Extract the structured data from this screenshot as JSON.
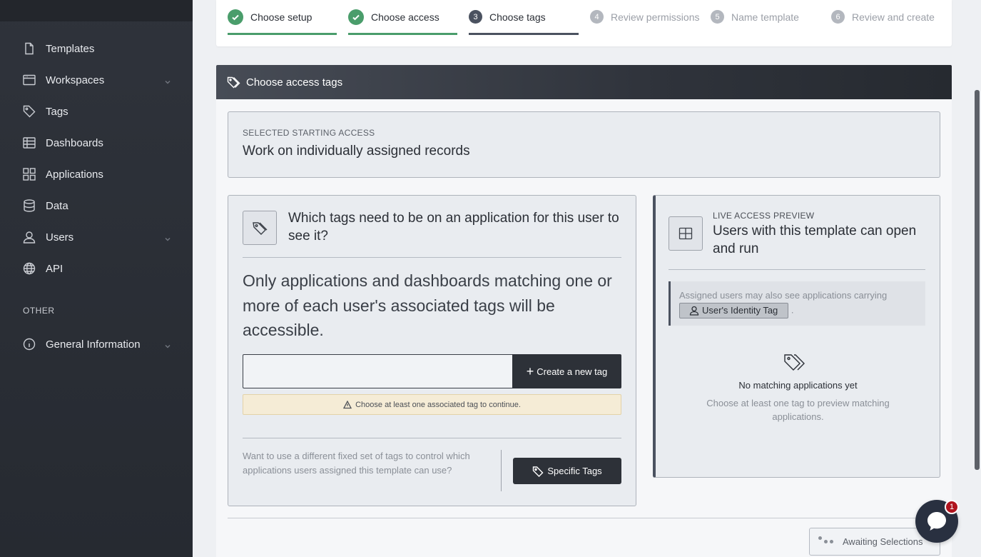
{
  "sidebar": {
    "items": [
      {
        "label": "Templates",
        "icon": "document-icon"
      },
      {
        "label": "Workspaces",
        "icon": "window-icon",
        "expandable": true
      },
      {
        "label": "Tags",
        "icon": "tag-icon"
      },
      {
        "label": "Dashboards",
        "icon": "table-icon"
      },
      {
        "label": "Applications",
        "icon": "grid-icon"
      },
      {
        "label": "Data",
        "icon": "database-icon"
      },
      {
        "label": "Users",
        "icon": "user-icon",
        "expandable": true
      },
      {
        "label": "API",
        "icon": "globe-icon"
      }
    ],
    "section_other": "OTHER",
    "general_info": {
      "label": "General Information",
      "icon": "info-icon",
      "expandable": true
    }
  },
  "steps": [
    {
      "number": "1",
      "label": "Choose setup",
      "state": "done"
    },
    {
      "number": "2",
      "label": "Choose access",
      "state": "done"
    },
    {
      "number": "3",
      "label": "Choose tags",
      "state": "active"
    },
    {
      "number": "4",
      "label": "Review permissions",
      "state": "pending"
    },
    {
      "number": "5",
      "label": "Name template",
      "state": "pending"
    },
    {
      "number": "6",
      "label": "Review and create",
      "state": "pending"
    }
  ],
  "panel": {
    "title": "Choose access tags",
    "starting": {
      "caption": "SELECTED STARTING ACCESS",
      "value": "Work on individually assigned records"
    },
    "tags": {
      "question": "Which tags need to be on an application for this user to see it?",
      "description": "Only applications and dashboards matching one or more of each user's associated tags will be accessible.",
      "input_value": "",
      "create_button": "Create a new tag",
      "warning": "Choose at least one associated tag to continue.",
      "alt_text": "Want to use a different fixed set of tags to control which applications users assigned this template can use?",
      "specific_button": "Specific Tags"
    },
    "preview": {
      "caption": "LIVE ACCESS PREVIEW",
      "title": "Users with this template can open and run",
      "note": "Assigned users may also see applications carrying",
      "identity_tag": "User's Identity Tag",
      "note_suffix": ".",
      "empty_title": "No matching applications yet",
      "empty_sub": "Choose at least one tag to preview matching applications."
    },
    "status_button": "Awaiting Selections"
  },
  "chat": {
    "badge": "1"
  },
  "colors": {
    "sidebar_bg": "#2f333b",
    "success": "#4a9d6b",
    "active_step": "#4b5260",
    "primary_button": "#2d3138",
    "warning_bg": "#f5ecd6",
    "badge": "#b0141e"
  }
}
